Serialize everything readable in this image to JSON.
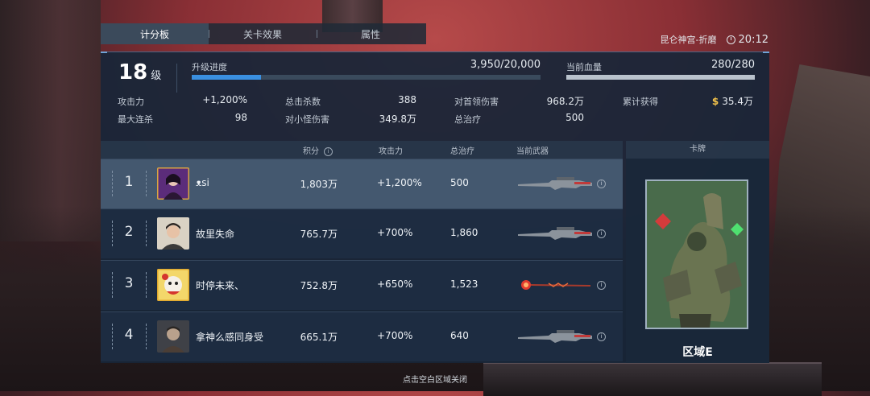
{
  "tabs": [
    {
      "label": "计分板",
      "active": true
    },
    {
      "label": "关卡效果",
      "active": false
    },
    {
      "label": "属性",
      "active": false
    }
  ],
  "location": "昆仑神宫-折磨",
  "clock": "20:12",
  "level": {
    "num": "18",
    "unit": "级"
  },
  "progress": {
    "label": "升级进度",
    "value": "3,950/20,000",
    "fraction": 0.1975
  },
  "hp": {
    "label": "当前血量",
    "value": "280/280",
    "fraction": 1.0
  },
  "stats": [
    {
      "label": "攻击力",
      "value": "+1,200%"
    },
    {
      "label": "总击杀数",
      "value": "388"
    },
    {
      "label": "对首领伤害",
      "value": "968.2万"
    },
    {
      "label": "累计获得",
      "value": "35.4万",
      "icon": "$"
    },
    {
      "label": "最大连杀",
      "value": "98"
    },
    {
      "label": "对小怪伤害",
      "value": "349.8万"
    },
    {
      "label": "总治疗",
      "value": "500"
    }
  ],
  "table": {
    "headers": {
      "score": "积分",
      "atk": "攻击力",
      "heal": "总治疗",
      "weapon": "当前武器",
      "card": "卡牌"
    },
    "rows": [
      {
        "rank": "1",
        "name": "ᴥsi",
        "score": "1,803万",
        "atk": "+1,200%",
        "heal": "500",
        "weapon": "rifle-icon",
        "self": true
      },
      {
        "rank": "2",
        "name": "故里失命",
        "score": "765.7万",
        "atk": "+700%",
        "heal": "1,860",
        "weapon": "rifle-icon",
        "self": false
      },
      {
        "rank": "3",
        "name": "时停未来、",
        "score": "752.8万",
        "atk": "+650%",
        "heal": "1,523",
        "weapon": "staff-icon",
        "self": false
      },
      {
        "rank": "4",
        "name": "拿神么感同身受",
        "score": "665.1万",
        "atk": "+700%",
        "heal": "640",
        "weapon": "rifle-icon",
        "self": false
      }
    ]
  },
  "card": {
    "name": "区域E"
  },
  "close_hint": "点击空白区域关闭",
  "colors": {
    "accent": "#3a8fe0",
    "gold": "#f2c34b",
    "panel": "#182638"
  }
}
